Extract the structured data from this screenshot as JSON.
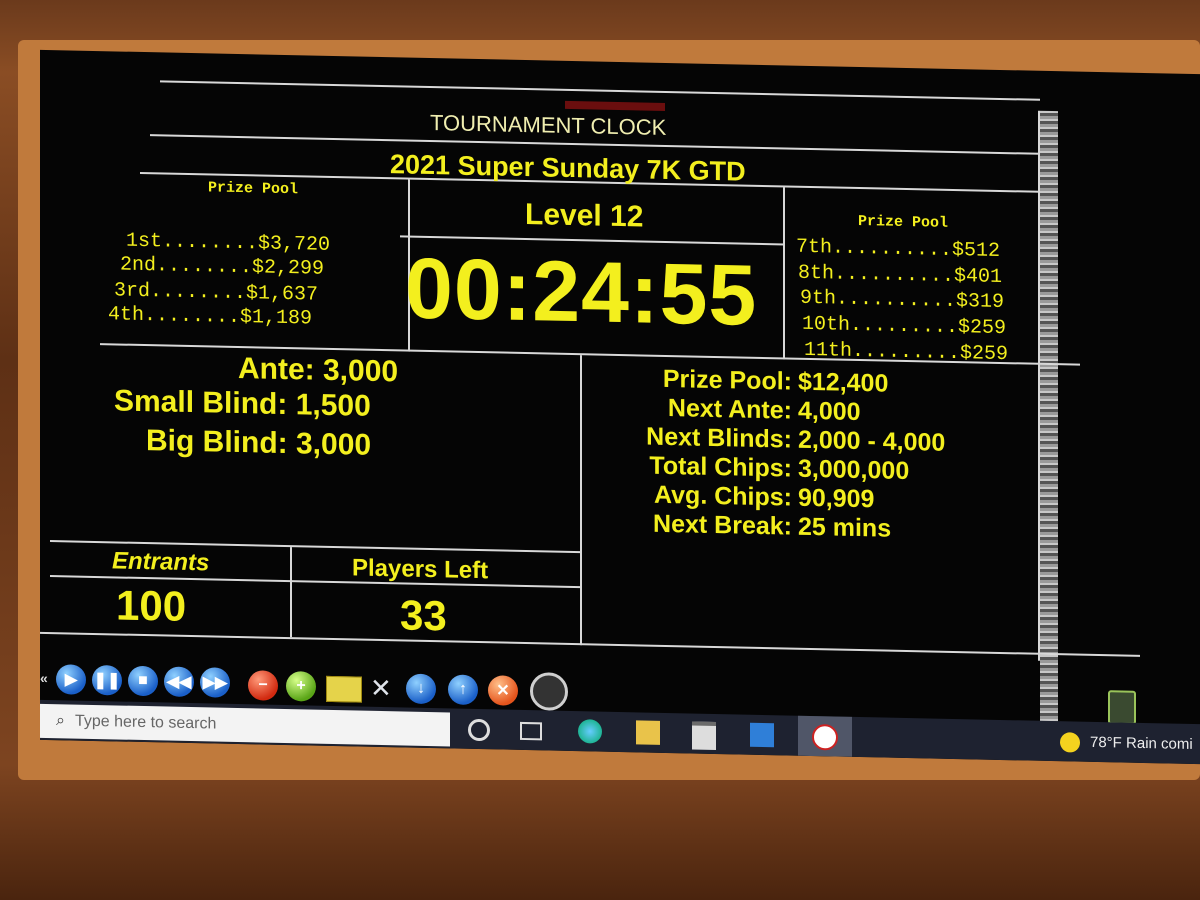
{
  "header": {
    "window_title": "TOURNAMENT CLOCK",
    "tournament_name": "2021 Super Sunday 7K GTD"
  },
  "level": "Level 12",
  "timer": "00:24:55",
  "prize_pool_left": {
    "heading": "Prize Pool",
    "rows": [
      "1st........$3,720",
      "2nd........$2,299",
      "3rd........$1,637",
      "4th........$1,189"
    ]
  },
  "prize_pool_right": {
    "heading": "Prize Pool",
    "rows": [
      "7th..........$512",
      "8th..........$401",
      "9th..........$319",
      "10th.........$259",
      "11th.........$259"
    ]
  },
  "blinds": {
    "ante_label": "Ante:",
    "ante_value": "3,000",
    "small_label": "Small Blind:",
    "small_value": "1,500",
    "big_label": "Big Blind:",
    "big_value": "3,000"
  },
  "info": {
    "prize_pool_label": "Prize Pool:",
    "prize_pool_value": "$12,400",
    "next_ante_label": "Next Ante:",
    "next_ante_value": "4,000",
    "next_blinds_label": "Next Blinds:",
    "next_blinds_value": "2,000 - 4,000",
    "total_chips_label": "Total Chips:",
    "total_chips_value": "3,000,000",
    "avg_chips_label": "Avg. Chips:",
    "avg_chips_value": "90,909",
    "next_break_label": "Next Break:",
    "next_break_value": "25 mins"
  },
  "counts": {
    "entrants_label": "Entrants",
    "entrants_value": "100",
    "players_left_label": "Players Left",
    "players_left_value": "33"
  },
  "toolbar": {
    "icons": [
      "rewind-small-icon",
      "play-icon",
      "pause-icon",
      "stop-icon",
      "rewind-icon",
      "fast-forward-icon",
      "minus-icon",
      "plus-icon",
      "folder-icon",
      "settings-icon",
      "down-icon",
      "up-icon",
      "close-icon",
      "alarm-clock-icon"
    ]
  },
  "taskbar": {
    "search_placeholder": "Type here to search",
    "weather": "78°F  Rain comi"
  },
  "colors": {
    "text_yellow": "#f3ef1e",
    "screen_bg": "#050505",
    "grid_line": "#d8d8d8"
  }
}
